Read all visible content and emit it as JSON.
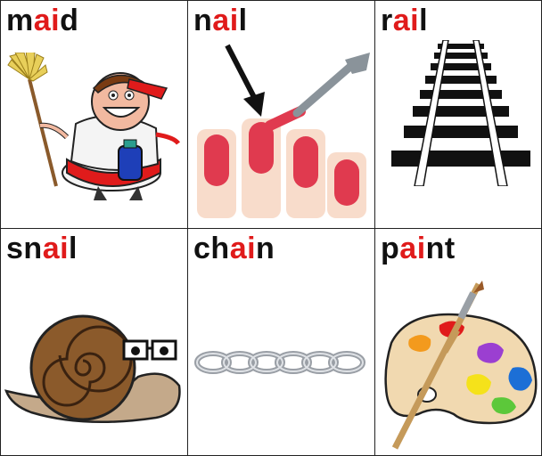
{
  "cards": [
    {
      "pre": "m",
      "hl": "ai",
      "post": "d",
      "picture": "maid-icon"
    },
    {
      "pre": "n",
      "hl": "ai",
      "post": "l",
      "picture": "nail-icon"
    },
    {
      "pre": "r",
      "hl": "ai",
      "post": "l",
      "picture": "rail-icon"
    },
    {
      "pre": "sn",
      "hl": "ai",
      "post": "l",
      "picture": "snail-icon"
    },
    {
      "pre": "ch",
      "hl": "ai",
      "post": "n",
      "picture": "chain-icon"
    },
    {
      "pre": "p",
      "hl": "ai",
      "post": "nt",
      "picture": "paint-palette-icon"
    }
  ],
  "colors": {
    "highlight": "#e01b1b",
    "text": "#111111",
    "border": "#222222"
  }
}
